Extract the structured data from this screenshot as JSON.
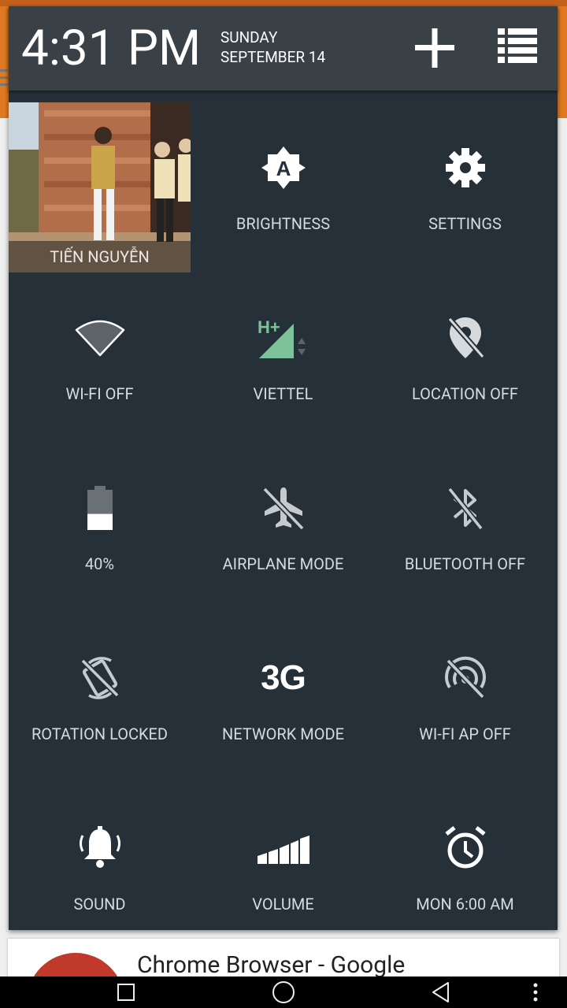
{
  "header": {
    "time": "4:31 PM",
    "day": "SUNDAY",
    "date": "SEPTEMBER 14"
  },
  "user": {
    "name": "TIẾN NGUYỄN"
  },
  "tiles": {
    "brightness": "BRIGHTNESS",
    "settings": "SETTINGS",
    "wifi": "WI-FI OFF",
    "mobile": "VIETTEL",
    "mobile_type": "H+",
    "location": "LOCATION OFF",
    "battery": "40%",
    "airplane": "AIRPLANE MODE",
    "bluetooth": "BLUETOOTH OFF",
    "rotation": "ROTATION LOCKED",
    "network": "NETWORK MODE",
    "network_icon_text": "3G",
    "wifi_ap": "WI-FI AP OFF",
    "sound": "SOUND",
    "volume": "VOLUME",
    "alarm": "MON 6:00 AM"
  },
  "battery_level": 0.4,
  "background": {
    "card_title": "Chrome Browser - Google"
  },
  "colors": {
    "accent": "#e07a22",
    "panel": "#263038",
    "header": "#394046",
    "signal": "#7cc39c"
  }
}
